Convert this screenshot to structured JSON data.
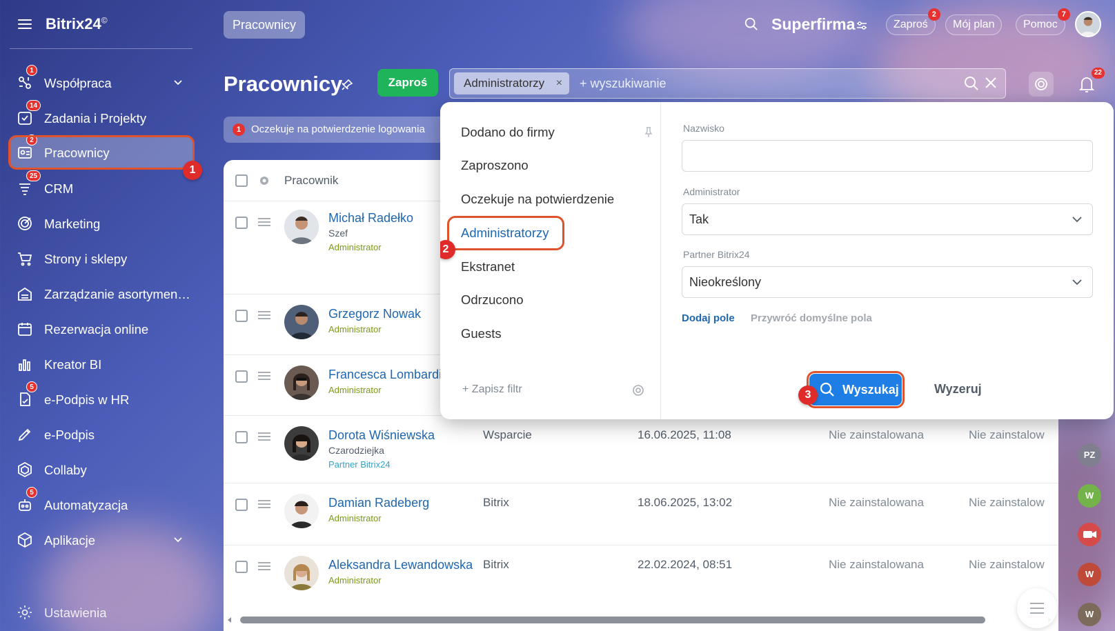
{
  "sidebar": {
    "logo": "Bitrix24",
    "logo_mark": "©",
    "items": [
      {
        "label": "Współpraca",
        "badge": "1",
        "icon": "collab-icon"
      },
      {
        "label": "Zadania i Projekty",
        "badge": "14",
        "icon": "tasks-icon"
      },
      {
        "label": "Pracownicy",
        "badge": "2",
        "icon": "employees-icon"
      },
      {
        "label": "CRM",
        "badge": "25",
        "icon": "crm-icon"
      },
      {
        "label": "Marketing",
        "icon": "marketing-icon"
      },
      {
        "label": "Strony i sklepy",
        "icon": "cart-icon"
      },
      {
        "label": "Zarządzanie asortymen…",
        "icon": "warehouse-icon"
      },
      {
        "label": "Rezerwacja online",
        "icon": "calendar-icon"
      },
      {
        "label": "Kreator BI",
        "icon": "chart-icon"
      },
      {
        "label": "e-Podpis w HR",
        "badge": "5",
        "icon": "hr-sign-icon"
      },
      {
        "label": "e-Podpis",
        "icon": "pen-icon"
      },
      {
        "label": "Collaby",
        "icon": "collaby-icon"
      },
      {
        "label": "Automatyzacja",
        "badge": "5",
        "icon": "robot-icon"
      },
      {
        "label": "Aplikacje",
        "icon": "apps-icon"
      }
    ],
    "settings_label": "Ustawienia"
  },
  "topbar": {
    "tab_label": "Pracownicy",
    "company": "Superfirma",
    "invite_label": "Zaproś",
    "invite_badge": "2",
    "plan_label": "Mój plan",
    "help_label": "Pomoc",
    "help_badge": "7"
  },
  "page": {
    "title": "Pracownicy",
    "invite_button": "Zaproś",
    "filter_chip": "Administratorzy",
    "chip_close": "×",
    "search_placeholder": "+ wyszukiwanie",
    "bell_badge": "22",
    "notice_count": "1",
    "notice_text": "Oczekuje na potwierdzenie logowania"
  },
  "table": {
    "header": {
      "employee": "Pracownik"
    },
    "rows": [
      {
        "name": "Michał Radełko",
        "position": "Szef",
        "role": "Administrator",
        "role_type": "admin",
        "dept": "",
        "date": "",
        "app": "",
        "app2": ""
      },
      {
        "name": "Grzegorz Nowak",
        "position": "",
        "role": "Administrator",
        "role_type": "admin",
        "dept": "",
        "date": "",
        "app": "",
        "app2": ""
      },
      {
        "name": "Francesca Lombardi",
        "position": "",
        "role": "Administrator",
        "role_type": "admin",
        "dept": "",
        "date": "",
        "app": "",
        "app2": ""
      },
      {
        "name": "Dorota Wiśniewska",
        "position": "Czarodziejka",
        "role": "Partner Bitrix24",
        "role_type": "partner",
        "dept": "Wsparcie",
        "date": "16.06.2025, 11:08",
        "app": "Nie zainstalowana",
        "app2": "Nie zainstalow"
      },
      {
        "name": "Damian Radeberg",
        "position": "",
        "role": "Administrator",
        "role_type": "admin",
        "dept": "Bitrix",
        "date": "18.06.2025, 13:02",
        "app": "Nie zainstalowana",
        "app2": "Nie zainstalow"
      },
      {
        "name": "Aleksandra Lewandowska",
        "position": "",
        "role": "Administrator",
        "role_type": "admin",
        "dept": "Bitrix",
        "date": "22.02.2024, 08:51",
        "app": "Nie zainstalowana",
        "app2": "Nie zainstalow"
      }
    ]
  },
  "filter": {
    "presets": [
      "Dodano do firmy",
      "Zaproszono",
      "Oczekuje na potwierdzenie",
      "Administratorzy",
      "Ekstranet",
      "Odrzucono",
      "Guests"
    ],
    "selected_preset": "Administratorzy",
    "save_filter": "+ Zapisz filtr",
    "fields": {
      "surname_label": "Nazwisko",
      "surname_value": "",
      "admin_label": "Administrator",
      "admin_value": "Tak",
      "partner_label": "Partner Bitrix24",
      "partner_value": "Nieokreślony"
    },
    "add_field": "Dodaj pole",
    "restore_fields": "Przywróć domyślne pola",
    "search_button": "Wyszukaj",
    "reset_button": "Wyzeruj"
  },
  "steps": [
    "1",
    "2",
    "3"
  ],
  "right_rail": [
    "PZ",
    "W",
    "W",
    "W"
  ],
  "colors": {
    "accent": "#2067b0",
    "primary_button": "#1f7ee6",
    "success": "#1fb35a",
    "badge": "#e5312f",
    "highlight": "#e0522b",
    "admin_role": "#7a9b14",
    "partner_role": "#2fa6c9"
  }
}
